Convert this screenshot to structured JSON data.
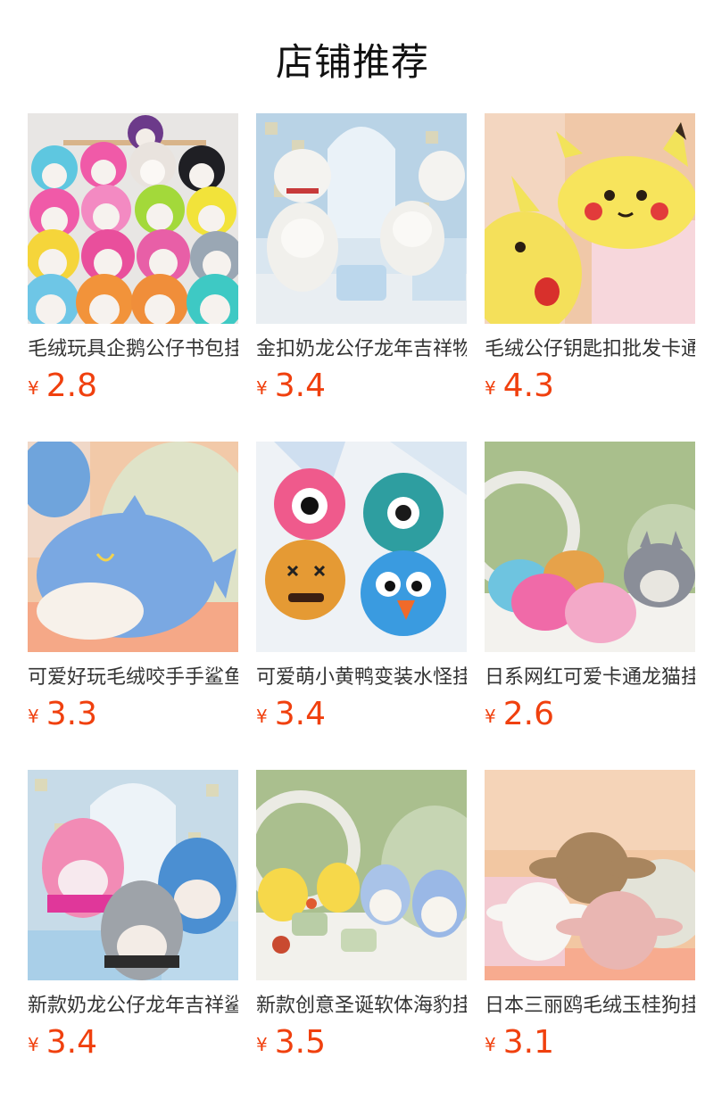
{
  "section": {
    "title": "店铺推荐"
  },
  "currency": "¥",
  "products": [
    {
      "name": "毛绒玩具企鹅公仔书包挂件",
      "price": "2.8",
      "image": "penguin-plush-image"
    },
    {
      "name": "金扣奶龙公仔龙年吉祥物",
      "price": "3.4",
      "image": "white-sheep-plush-image"
    },
    {
      "name": "毛绒公仔钥匙扣批发卡通",
      "price": "4.3",
      "image": "yellow-pikachu-plush-image"
    },
    {
      "name": "可爱好玩毛绒咬手手鲨鱼",
      "price": "3.3",
      "image": "blue-shark-plush-image"
    },
    {
      "name": "可爱萌小黄鸭变装水怪挂件",
      "price": "3.4",
      "image": "monster-plush-image"
    },
    {
      "name": "日系网红可爱卡通龙猫挂件",
      "price": "2.6",
      "image": "totoro-plush-image"
    },
    {
      "name": "新款奶龙公仔龙年吉祥鲨鱼",
      "price": "3.4",
      "image": "shark-trio-plush-image"
    },
    {
      "name": "新款创意圣诞软体海豹挂件",
      "price": "3.5",
      "image": "chick-penguin-plush-image"
    },
    {
      "name": "日本三丽鸥毛绒玉桂狗挂件",
      "price": "3.1",
      "image": "cinnamoroll-plush-image"
    }
  ]
}
